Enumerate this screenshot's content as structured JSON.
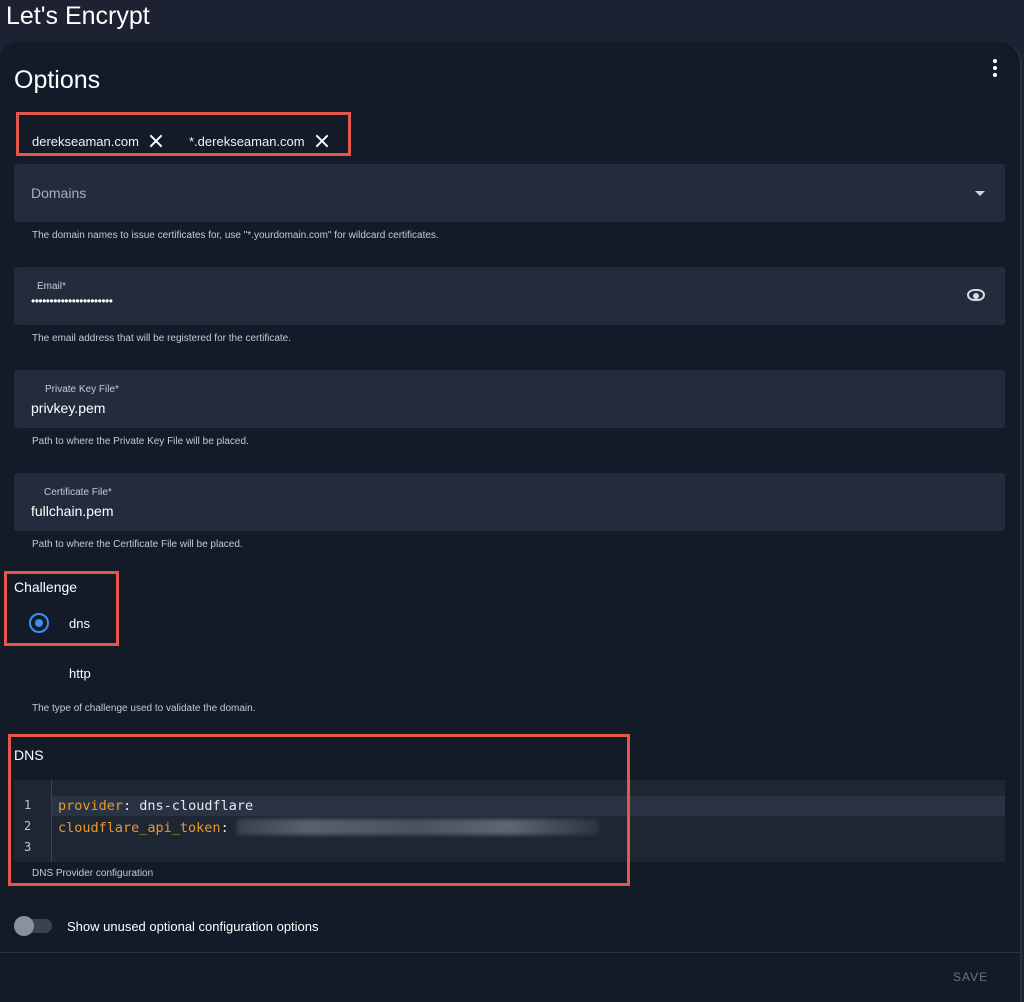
{
  "app": {
    "title": "Let's Encrypt"
  },
  "card": {
    "title": "Options",
    "menu_icon": "more-vertical-icon"
  },
  "domains": {
    "chips": [
      "derekseaman.com",
      "*.derekseaman.com"
    ],
    "placeholder": "Domains",
    "helper": "The domain names to issue certificates for, use \"*.yourdomain.com\" for wildcard certificates."
  },
  "email": {
    "label": "Email*",
    "value": "••••••••••••••••••••••",
    "helper": "The email address that will be registered for the certificate.",
    "icon": "eye-icon"
  },
  "private_key": {
    "label": "Private Key File*",
    "value": "privkey.pem",
    "helper": "Path to where the Private Key File will be placed."
  },
  "certificate": {
    "label": "Certificate File*",
    "value": "fullchain.pem",
    "helper": "Path to where the Certificate File will be placed."
  },
  "challenge": {
    "title": "Challenge",
    "options": [
      "dns",
      "http"
    ],
    "selected": "dns",
    "helper": "The type of challenge used to validate the domain."
  },
  "dns": {
    "title": "DNS",
    "line_numbers": [
      "1",
      "2",
      "3"
    ],
    "lines": [
      {
        "key": "provider",
        "sep": ": ",
        "value": "dns-cloudflare"
      },
      {
        "key": "cloudflare_api_token",
        "sep": ": ",
        "value": ""
      },
      {
        "key": "",
        "sep": "",
        "value": ""
      }
    ],
    "helper": "DNS Provider configuration"
  },
  "footer": {
    "toggle_label": "Show unused optional configuration options",
    "toggle_on": false,
    "save_label": "SAVE"
  },
  "colors": {
    "accent": "#3f8df2",
    "highlight_box": "#e5574b",
    "yaml_key": "#e89b2c"
  }
}
